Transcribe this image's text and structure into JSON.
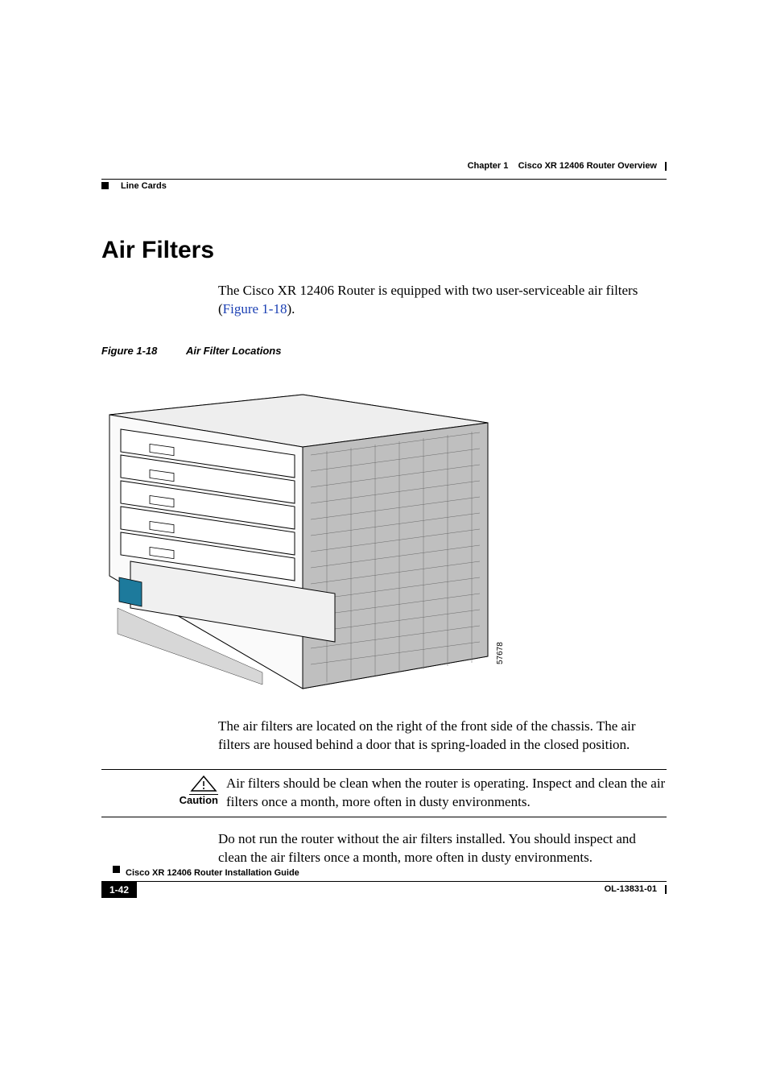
{
  "header": {
    "chapter_label": "Chapter 1",
    "chapter_title": "Cisco XR 12406 Router Overview",
    "section_crumb": "Line Cards"
  },
  "section": {
    "heading": "Air Filters",
    "intro_prefix": "The Cisco XR 12406 Router is equipped with two user-serviceable air filters (",
    "intro_link": "Figure 1-18",
    "intro_suffix": ")."
  },
  "figure": {
    "number": "Figure 1-18",
    "title": "Air Filter Locations",
    "annotation": "57678"
  },
  "para_after_figure": "The air filters are located on the right of the front side of the chassis. The air filters are housed behind a door that is spring-loaded in the closed position.",
  "caution": {
    "label": "Caution",
    "text": "Air filters should be clean when the router is operating. Inspect and clean the air filters once a month, more often in dusty environments."
  },
  "para_after_caution": "Do not run the router without the air filters installed. You should inspect and clean the air filters once a month, more often in dusty environments.",
  "footer": {
    "guide": "Cisco XR 12406 Router Installation Guide",
    "page": "1-42",
    "docnum": "OL-13831-01"
  }
}
